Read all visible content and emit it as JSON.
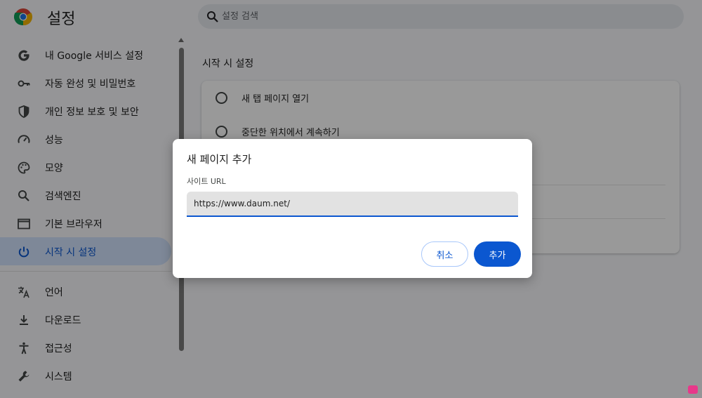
{
  "header": {
    "app_title": "설정",
    "search_placeholder": "설정 검색"
  },
  "sidebar": {
    "items": [
      {
        "label": "내 Google 서비스 설정",
        "icon": "google-icon"
      },
      {
        "label": "자동 완성 및 비밀번호",
        "icon": "key-icon"
      },
      {
        "label": "개인 정보 보호 및 보안",
        "icon": "shield-icon"
      },
      {
        "label": "성능",
        "icon": "speedometer-icon"
      },
      {
        "label": "모양",
        "icon": "palette-icon"
      },
      {
        "label": "검색엔진",
        "icon": "search-icon"
      },
      {
        "label": "기본 브라우저",
        "icon": "browser-window-icon"
      },
      {
        "label": "시작 시 설정",
        "icon": "power-icon",
        "active": true
      },
      {
        "label": "언어",
        "icon": "translate-icon"
      },
      {
        "label": "다운로드",
        "icon": "download-icon"
      },
      {
        "label": "접근성",
        "icon": "accessibility-icon"
      },
      {
        "label": "시스템",
        "icon": "wrench-icon"
      }
    ]
  },
  "main": {
    "section_title": "시작 시 설정",
    "options": [
      {
        "label": "새 탭 페이지 열기"
      },
      {
        "label": "중단한 위치에서 계속하기"
      }
    ]
  },
  "dialog": {
    "title": "새 페이지 추가",
    "field_label": "사이트 URL",
    "url_value": "https://www.daum.net/",
    "cancel_label": "취소",
    "add_label": "추가"
  },
  "colors": {
    "accent": "#0b57d0",
    "active_nav_bg": "#d3e3fd"
  }
}
